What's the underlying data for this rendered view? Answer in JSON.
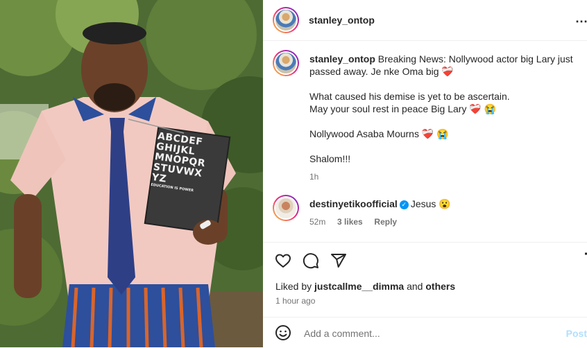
{
  "post": {
    "author": "stanley_ontop",
    "more_icon": "more-horizontal-icon",
    "caption": {
      "username": "stanley_ontop",
      "line1": "Breaking News: Nollywood actor big Lary just passed away. Je nke Oma big",
      "line2": "What caused his demise is yet to be ascertain.",
      "line3": "May your soul rest in peace Big Lary",
      "line4": "Nollywood Asaba Mourns",
      "line5": "Shalom!!!",
      "age": "1h",
      "emoji_heart": "❤️‍🩹",
      "emoji_cry": "😭"
    },
    "comments": [
      {
        "username": "destinyetikoofficial",
        "verified": true,
        "text": "Jesus",
        "emoji": "😮",
        "age": "52m",
        "likes": "3 likes",
        "reply": "Reply"
      }
    ],
    "likes_prefix": "Liked by",
    "liked_by": "justcallme__dimma",
    "likes_joiner": "and",
    "likes_suffix": "others",
    "timestamp": "1 hour ago",
    "add_comment_placeholder": "Add a comment...",
    "post_label": "Post"
  },
  "image": {
    "eye_chart_rows": [
      "ABCDEF",
      "GHIJKL",
      "MNOPQR",
      "STUVWX",
      "YZ"
    ],
    "eye_chart_caption": "EDUCATION IS POWER"
  },
  "colors": {
    "accent_blue": "#0095f6",
    "text_primary": "#262626",
    "text_secondary": "#737373"
  }
}
